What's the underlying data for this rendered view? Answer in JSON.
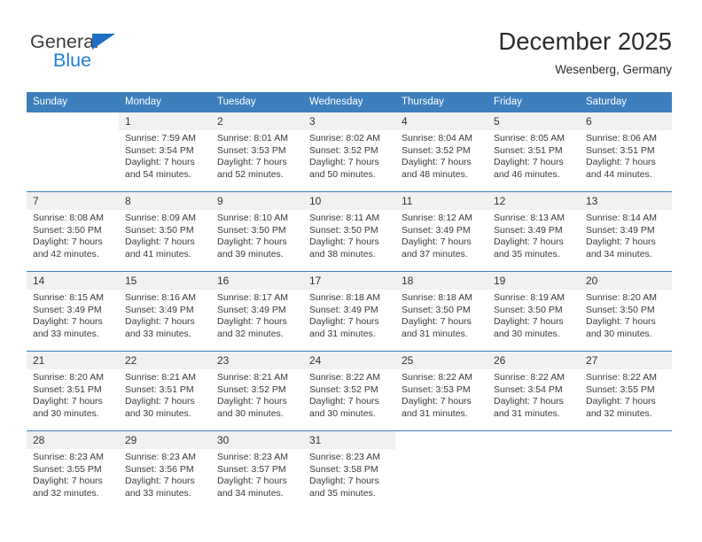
{
  "brand": {
    "name_part1": "General",
    "name_part2": "Blue",
    "triangle_color": "#1f6fc0",
    "blue_color": "#1f7fd4"
  },
  "header": {
    "title": "December 2025",
    "subtitle": "Wesenberg, Germany",
    "header_bg": "#3d7ebd",
    "number_band_bg": "#f1f1f1"
  },
  "weekdays": [
    "Sunday",
    "Monday",
    "Tuesday",
    "Wednesday",
    "Thursday",
    "Friday",
    "Saturday"
  ],
  "weeks": [
    {
      "days": [
        {
          "date": "",
          "sunrise": "",
          "sunset": "",
          "daylight_1": "",
          "daylight_2": ""
        },
        {
          "date": "1",
          "sunrise": "Sunrise: 7:59 AM",
          "sunset": "Sunset: 3:54 PM",
          "daylight_1": "Daylight: 7 hours",
          "daylight_2": "and 54 minutes."
        },
        {
          "date": "2",
          "sunrise": "Sunrise: 8:01 AM",
          "sunset": "Sunset: 3:53 PM",
          "daylight_1": "Daylight: 7 hours",
          "daylight_2": "and 52 minutes."
        },
        {
          "date": "3",
          "sunrise": "Sunrise: 8:02 AM",
          "sunset": "Sunset: 3:52 PM",
          "daylight_1": "Daylight: 7 hours",
          "daylight_2": "and 50 minutes."
        },
        {
          "date": "4",
          "sunrise": "Sunrise: 8:04 AM",
          "sunset": "Sunset: 3:52 PM",
          "daylight_1": "Daylight: 7 hours",
          "daylight_2": "and 48 minutes."
        },
        {
          "date": "5",
          "sunrise": "Sunrise: 8:05 AM",
          "sunset": "Sunset: 3:51 PM",
          "daylight_1": "Daylight: 7 hours",
          "daylight_2": "and 46 minutes."
        },
        {
          "date": "6",
          "sunrise": "Sunrise: 8:06 AM",
          "sunset": "Sunset: 3:51 PM",
          "daylight_1": "Daylight: 7 hours",
          "daylight_2": "and 44 minutes."
        }
      ]
    },
    {
      "days": [
        {
          "date": "7",
          "sunrise": "Sunrise: 8:08 AM",
          "sunset": "Sunset: 3:50 PM",
          "daylight_1": "Daylight: 7 hours",
          "daylight_2": "and 42 minutes."
        },
        {
          "date": "8",
          "sunrise": "Sunrise: 8:09 AM",
          "sunset": "Sunset: 3:50 PM",
          "daylight_1": "Daylight: 7 hours",
          "daylight_2": "and 41 minutes."
        },
        {
          "date": "9",
          "sunrise": "Sunrise: 8:10 AM",
          "sunset": "Sunset: 3:50 PM",
          "daylight_1": "Daylight: 7 hours",
          "daylight_2": "and 39 minutes."
        },
        {
          "date": "10",
          "sunrise": "Sunrise: 8:11 AM",
          "sunset": "Sunset: 3:50 PM",
          "daylight_1": "Daylight: 7 hours",
          "daylight_2": "and 38 minutes."
        },
        {
          "date": "11",
          "sunrise": "Sunrise: 8:12 AM",
          "sunset": "Sunset: 3:49 PM",
          "daylight_1": "Daylight: 7 hours",
          "daylight_2": "and 37 minutes."
        },
        {
          "date": "12",
          "sunrise": "Sunrise: 8:13 AM",
          "sunset": "Sunset: 3:49 PM",
          "daylight_1": "Daylight: 7 hours",
          "daylight_2": "and 35 minutes."
        },
        {
          "date": "13",
          "sunrise": "Sunrise: 8:14 AM",
          "sunset": "Sunset: 3:49 PM",
          "daylight_1": "Daylight: 7 hours",
          "daylight_2": "and 34 minutes."
        }
      ]
    },
    {
      "days": [
        {
          "date": "14",
          "sunrise": "Sunrise: 8:15 AM",
          "sunset": "Sunset: 3:49 PM",
          "daylight_1": "Daylight: 7 hours",
          "daylight_2": "and 33 minutes."
        },
        {
          "date": "15",
          "sunrise": "Sunrise: 8:16 AM",
          "sunset": "Sunset: 3:49 PM",
          "daylight_1": "Daylight: 7 hours",
          "daylight_2": "and 33 minutes."
        },
        {
          "date": "16",
          "sunrise": "Sunrise: 8:17 AM",
          "sunset": "Sunset: 3:49 PM",
          "daylight_1": "Daylight: 7 hours",
          "daylight_2": "and 32 minutes."
        },
        {
          "date": "17",
          "sunrise": "Sunrise: 8:18 AM",
          "sunset": "Sunset: 3:49 PM",
          "daylight_1": "Daylight: 7 hours",
          "daylight_2": "and 31 minutes."
        },
        {
          "date": "18",
          "sunrise": "Sunrise: 8:18 AM",
          "sunset": "Sunset: 3:50 PM",
          "daylight_1": "Daylight: 7 hours",
          "daylight_2": "and 31 minutes."
        },
        {
          "date": "19",
          "sunrise": "Sunrise: 8:19 AM",
          "sunset": "Sunset: 3:50 PM",
          "daylight_1": "Daylight: 7 hours",
          "daylight_2": "and 30 minutes."
        },
        {
          "date": "20",
          "sunrise": "Sunrise: 8:20 AM",
          "sunset": "Sunset: 3:50 PM",
          "daylight_1": "Daylight: 7 hours",
          "daylight_2": "and 30 minutes."
        }
      ]
    },
    {
      "days": [
        {
          "date": "21",
          "sunrise": "Sunrise: 8:20 AM",
          "sunset": "Sunset: 3:51 PM",
          "daylight_1": "Daylight: 7 hours",
          "daylight_2": "and 30 minutes."
        },
        {
          "date": "22",
          "sunrise": "Sunrise: 8:21 AM",
          "sunset": "Sunset: 3:51 PM",
          "daylight_1": "Daylight: 7 hours",
          "daylight_2": "and 30 minutes."
        },
        {
          "date": "23",
          "sunrise": "Sunrise: 8:21 AM",
          "sunset": "Sunset: 3:52 PM",
          "daylight_1": "Daylight: 7 hours",
          "daylight_2": "and 30 minutes."
        },
        {
          "date": "24",
          "sunrise": "Sunrise: 8:22 AM",
          "sunset": "Sunset: 3:52 PM",
          "daylight_1": "Daylight: 7 hours",
          "daylight_2": "and 30 minutes."
        },
        {
          "date": "25",
          "sunrise": "Sunrise: 8:22 AM",
          "sunset": "Sunset: 3:53 PM",
          "daylight_1": "Daylight: 7 hours",
          "daylight_2": "and 31 minutes."
        },
        {
          "date": "26",
          "sunrise": "Sunrise: 8:22 AM",
          "sunset": "Sunset: 3:54 PM",
          "daylight_1": "Daylight: 7 hours",
          "daylight_2": "and 31 minutes."
        },
        {
          "date": "27",
          "sunrise": "Sunrise: 8:22 AM",
          "sunset": "Sunset: 3:55 PM",
          "daylight_1": "Daylight: 7 hours",
          "daylight_2": "and 32 minutes."
        }
      ]
    },
    {
      "days": [
        {
          "date": "28",
          "sunrise": "Sunrise: 8:23 AM",
          "sunset": "Sunset: 3:55 PM",
          "daylight_1": "Daylight: 7 hours",
          "daylight_2": "and 32 minutes."
        },
        {
          "date": "29",
          "sunrise": "Sunrise: 8:23 AM",
          "sunset": "Sunset: 3:56 PM",
          "daylight_1": "Daylight: 7 hours",
          "daylight_2": "and 33 minutes."
        },
        {
          "date": "30",
          "sunrise": "Sunrise: 8:23 AM",
          "sunset": "Sunset: 3:57 PM",
          "daylight_1": "Daylight: 7 hours",
          "daylight_2": "and 34 minutes."
        },
        {
          "date": "31",
          "sunrise": "Sunrise: 8:23 AM",
          "sunset": "Sunset: 3:58 PM",
          "daylight_1": "Daylight: 7 hours",
          "daylight_2": "and 35 minutes."
        },
        {
          "date": "",
          "sunrise": "",
          "sunset": "",
          "daylight_1": "",
          "daylight_2": ""
        },
        {
          "date": "",
          "sunrise": "",
          "sunset": "",
          "daylight_1": "",
          "daylight_2": ""
        },
        {
          "date": "",
          "sunrise": "",
          "sunset": "",
          "daylight_1": "",
          "daylight_2": ""
        }
      ]
    }
  ]
}
